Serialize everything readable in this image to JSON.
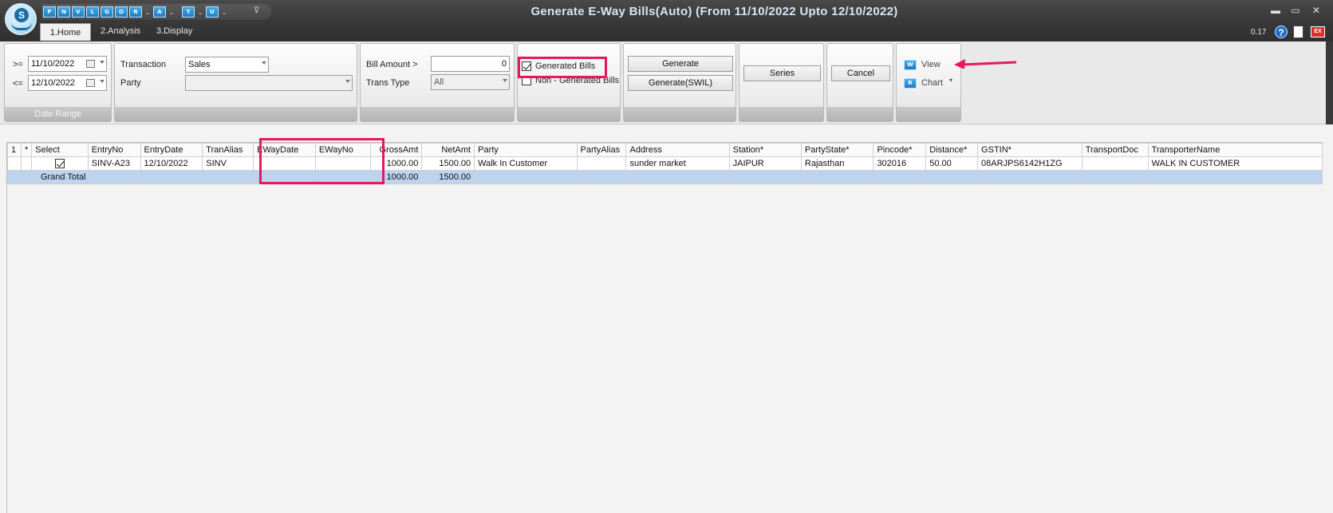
{
  "window": {
    "title": "Generate E-Way Bills(Auto) (From 11/10/2022 Upto 12/10/2022)",
    "zoom": "0.17",
    "minimize": "▬",
    "maximize": "▭",
    "close": "✕"
  },
  "quick_access": {
    "buttons": [
      "P",
      "N",
      "V",
      "L",
      "G",
      "O",
      "R",
      "A",
      "T",
      "U"
    ],
    "more": "⊽"
  },
  "tabs": [
    {
      "label": "1.Home"
    },
    {
      "label": "2.Analysis"
    },
    {
      "label": "3.Display"
    }
  ],
  "date_range": {
    "from_label": ">=",
    "from_value": "11/10/2022",
    "to_label": "<=",
    "to_value": "12/10/2022",
    "group_label": "Date Range"
  },
  "transaction": {
    "transaction_label": "Transaction",
    "transaction_value": "Sales",
    "party_label": "Party",
    "party_value": ""
  },
  "bill": {
    "amount_label": "Bill Amount >",
    "amount_value": "0",
    "trans_type_label": "Trans Type",
    "trans_type_value": "All"
  },
  "filters": {
    "generated_label": "Generated Bills",
    "generated_checked": true,
    "non_generated_label": "Non - Generated Bills",
    "non_generated_checked": false
  },
  "actions": {
    "generate": "Generate",
    "generate_swil": "Generate(SWIL)",
    "series": "Series",
    "cancel": "Cancel",
    "view": "View",
    "chart": "Chart"
  },
  "grid": {
    "row_indicator": "1",
    "star": "*",
    "columns": [
      "Select",
      "EntryNo",
      "EntryDate",
      "TranAlias",
      "EWayDate",
      "EWayNo",
      "GrossAmt",
      "NetAmt",
      "Party",
      "PartyAlias",
      "Address",
      "Station*",
      "PartyState*",
      "Pincode*",
      "Distance*",
      "GSTIN*",
      "TransportDoc",
      "TransporterName"
    ],
    "rows": [
      {
        "select": true,
        "entry_no": "SINV-A23",
        "entry_date": "12/10/2022",
        "tran_alias": "SINV",
        "eway_date": "",
        "eway_no": "",
        "gross_amt": "1000.00",
        "net_amt": "1500.00",
        "party": "Walk In Customer",
        "party_alias": "",
        "address": "sunder market",
        "station": "JAIPUR",
        "party_state": "Rajasthan",
        "pincode": "302016",
        "distance": "50.00",
        "gstin": "08ARJPS6142H1ZG",
        "transport_doc": "",
        "transporter_name": "WALK IN CUSTOMER"
      }
    ],
    "total": {
      "label": "Grand Total",
      "gross_amt": "1000.00",
      "net_amt": "1500.00"
    }
  },
  "colors": {
    "highlight": "#e8185c",
    "total_row": "#bcd4ee",
    "title_text": "#d7e7f5"
  }
}
